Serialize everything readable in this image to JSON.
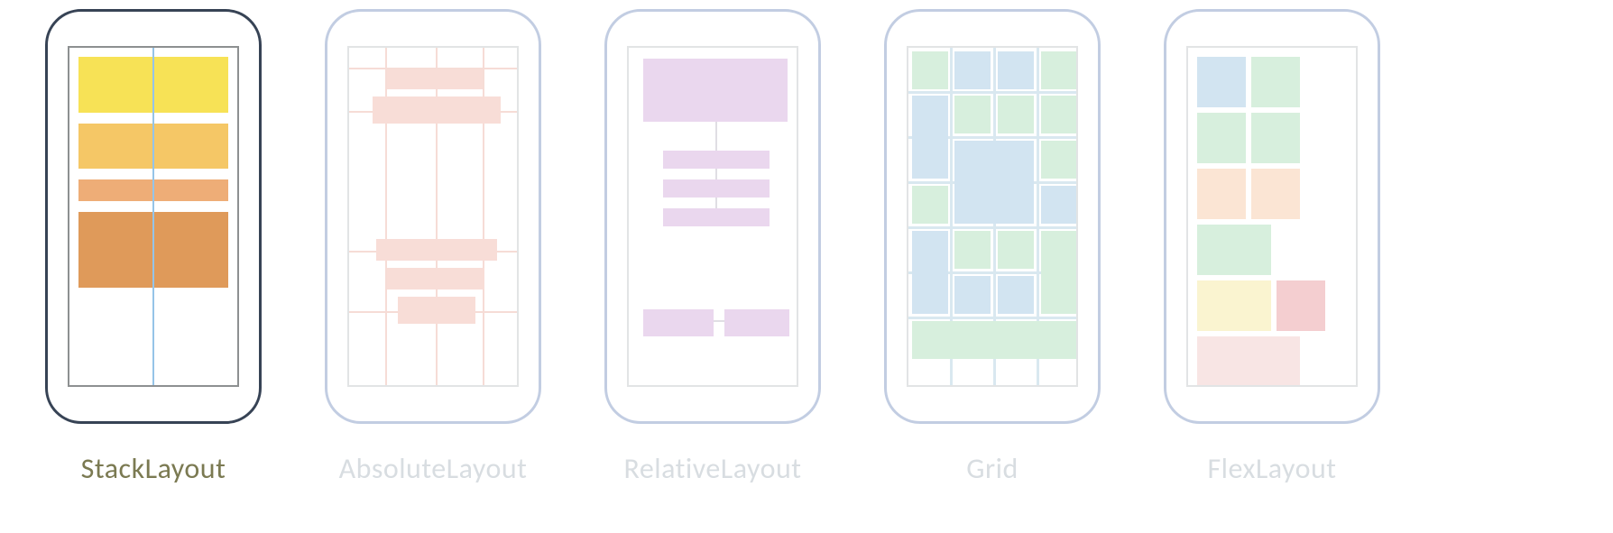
{
  "layouts": [
    {
      "id": "stack",
      "label": "StackLayout",
      "active": true
    },
    {
      "id": "absolute",
      "label": "AbsoluteLayout",
      "active": false
    },
    {
      "id": "relative",
      "label": "RelativeLayout",
      "active": false
    },
    {
      "id": "grid",
      "label": "Grid",
      "active": false
    },
    {
      "id": "flex",
      "label": "FlexLayout",
      "active": false
    }
  ],
  "colors": {
    "active_border": "#374355",
    "inactive_border": "#c2cde2",
    "active_label": "#7b7a52",
    "inactive_label": "#d8dde1",
    "stack_guide": "#95c4e8",
    "stack_blocks": [
      "#f7e256",
      "#f5c766",
      "#eead77",
      "#df9a5a"
    ],
    "absolute": "#f8ddd7",
    "relative": "#ead7ee",
    "grid_green": "#d7efdd",
    "grid_blue": "#d2e4f1",
    "flex_palette": [
      "#d2e4f1",
      "#d7efdd",
      "#fbe5d4",
      "#f4ced0",
      "#faf4d0"
    ]
  }
}
